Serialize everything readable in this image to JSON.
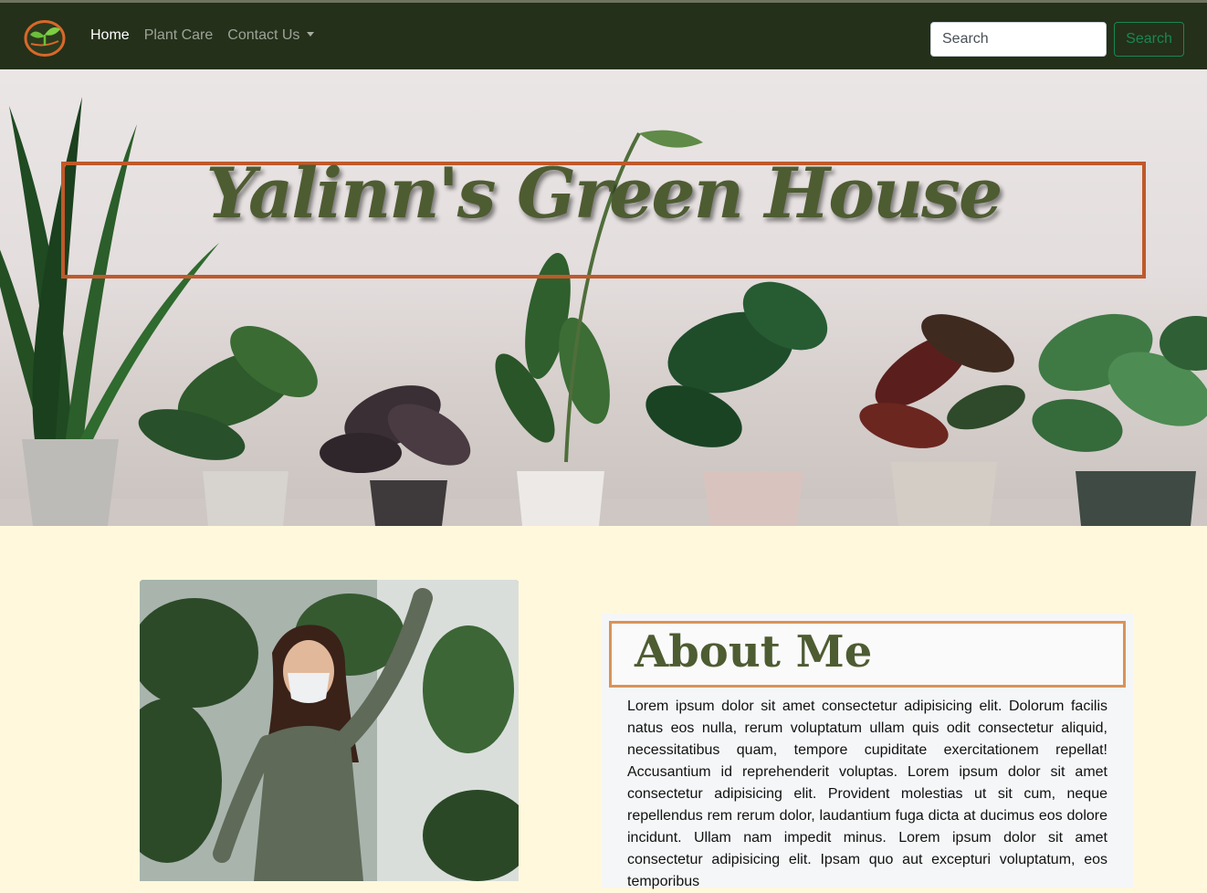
{
  "navbar": {
    "logo_icon": "sprout-logo-icon",
    "links": [
      {
        "label": "Home",
        "active": true
      },
      {
        "label": "Plant Care",
        "active": false
      },
      {
        "label": "Contact Us",
        "active": false,
        "dropdown": true
      }
    ],
    "search": {
      "placeholder": "Search",
      "button_label": "Search"
    }
  },
  "hero": {
    "title": "Yalinn's Green House"
  },
  "about": {
    "heading": "About Me",
    "body": "Lorem ipsum dolor sit amet consectetur adipisicing elit. Dolorum facilis natus eos nulla, rerum voluptatum ullam quis odit consectetur aliquid, necessitatibus quam, tempore cupiditate exercitationem repellat! Accusantium id reprehenderit voluptas. Lorem ipsum dolor sit amet consectetur adipisicing elit. Provident molestias ut sit cum, neque repellendus rem rerum dolor, laudantium fuga dicta at ducimus eos dolore incidunt. Ullam nam impedit minus. Lorem ipsum dolor sit amet consectetur adipisicing elit. Ipsam quo aut excepturi voluptatum, eos temporibus"
  },
  "colors": {
    "navbar_bg": "#243019",
    "title_border": "#c0592a",
    "title_text": "#4e5c32",
    "heading_border": "#d9935a",
    "page_bg": "#fff8dc",
    "search_button": "#198754"
  }
}
